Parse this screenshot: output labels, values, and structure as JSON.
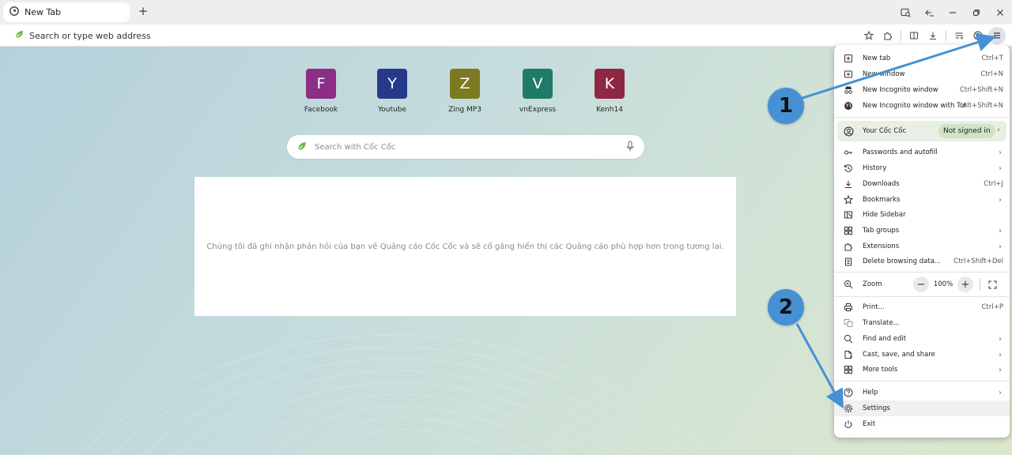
{
  "tab": {
    "title": "New Tab",
    "new_tab_symbol": "+"
  },
  "toolbar": {
    "omnibox_placeholder": "Search or type web address"
  },
  "shortcuts": [
    {
      "letter": "F",
      "label": "Facebook",
      "color": "#8c2e86"
    },
    {
      "letter": "Y",
      "label": "Youtube",
      "color": "#273a8a"
    },
    {
      "letter": "Z",
      "label": "Zing MP3",
      "color": "#7d7a22"
    },
    {
      "letter": "V",
      "label": "vnExpress",
      "color": "#1f7a67"
    },
    {
      "letter": "K",
      "label": "Kenh14",
      "color": "#8e2742"
    }
  ],
  "search": {
    "placeholder": "Search with Cốc Cốc"
  },
  "ad_feedback": "Chúng tôi đã ghi nhận phản hồi của bạn về Quảng cáo Cốc Cốc và sẽ cố gắng hiển thị các Quảng cáo phù hợp hơn trong tương lai.",
  "annotations": {
    "step1": "1",
    "step2": "2",
    "color": "#4691d4"
  },
  "menu": {
    "new_tab": {
      "label": "New tab",
      "shortcut": "Ctrl+T"
    },
    "new_window": {
      "label": "New window",
      "shortcut": "Ctrl+N"
    },
    "new_incognito": {
      "label": "New Incognito window",
      "shortcut": "Ctrl+Shift+N"
    },
    "new_incognito_tor": {
      "label": "New Incognito window with Tor",
      "shortcut": "Alt+Shift+N"
    },
    "profile": {
      "label": "Your Cốc Cốc",
      "status": "Not signed in"
    },
    "passwords": {
      "label": "Passwords and autofill"
    },
    "history": {
      "label": "History"
    },
    "downloads": {
      "label": "Downloads",
      "shortcut": "Ctrl+J"
    },
    "bookmarks": {
      "label": "Bookmarks"
    },
    "hide_sidebar": {
      "label": "Hide Sidebar"
    },
    "tab_groups": {
      "label": "Tab groups"
    },
    "extensions": {
      "label": "Extensions"
    },
    "delete_data": {
      "label": "Delete browsing data...",
      "shortcut": "Ctrl+Shift+Del"
    },
    "zoom": {
      "label": "Zoom",
      "value": "100%",
      "minus": "−",
      "plus": "+"
    },
    "print": {
      "label": "Print...",
      "shortcut": "Ctrl+P"
    },
    "translate": {
      "label": "Translate..."
    },
    "find_edit": {
      "label": "Find and edit"
    },
    "cast_save": {
      "label": "Cast, save, and share"
    },
    "more_tools": {
      "label": "More tools"
    },
    "help": {
      "label": "Help"
    },
    "settings": {
      "label": "Settings"
    },
    "exit": {
      "label": "Exit"
    },
    "arrow": "›"
  }
}
